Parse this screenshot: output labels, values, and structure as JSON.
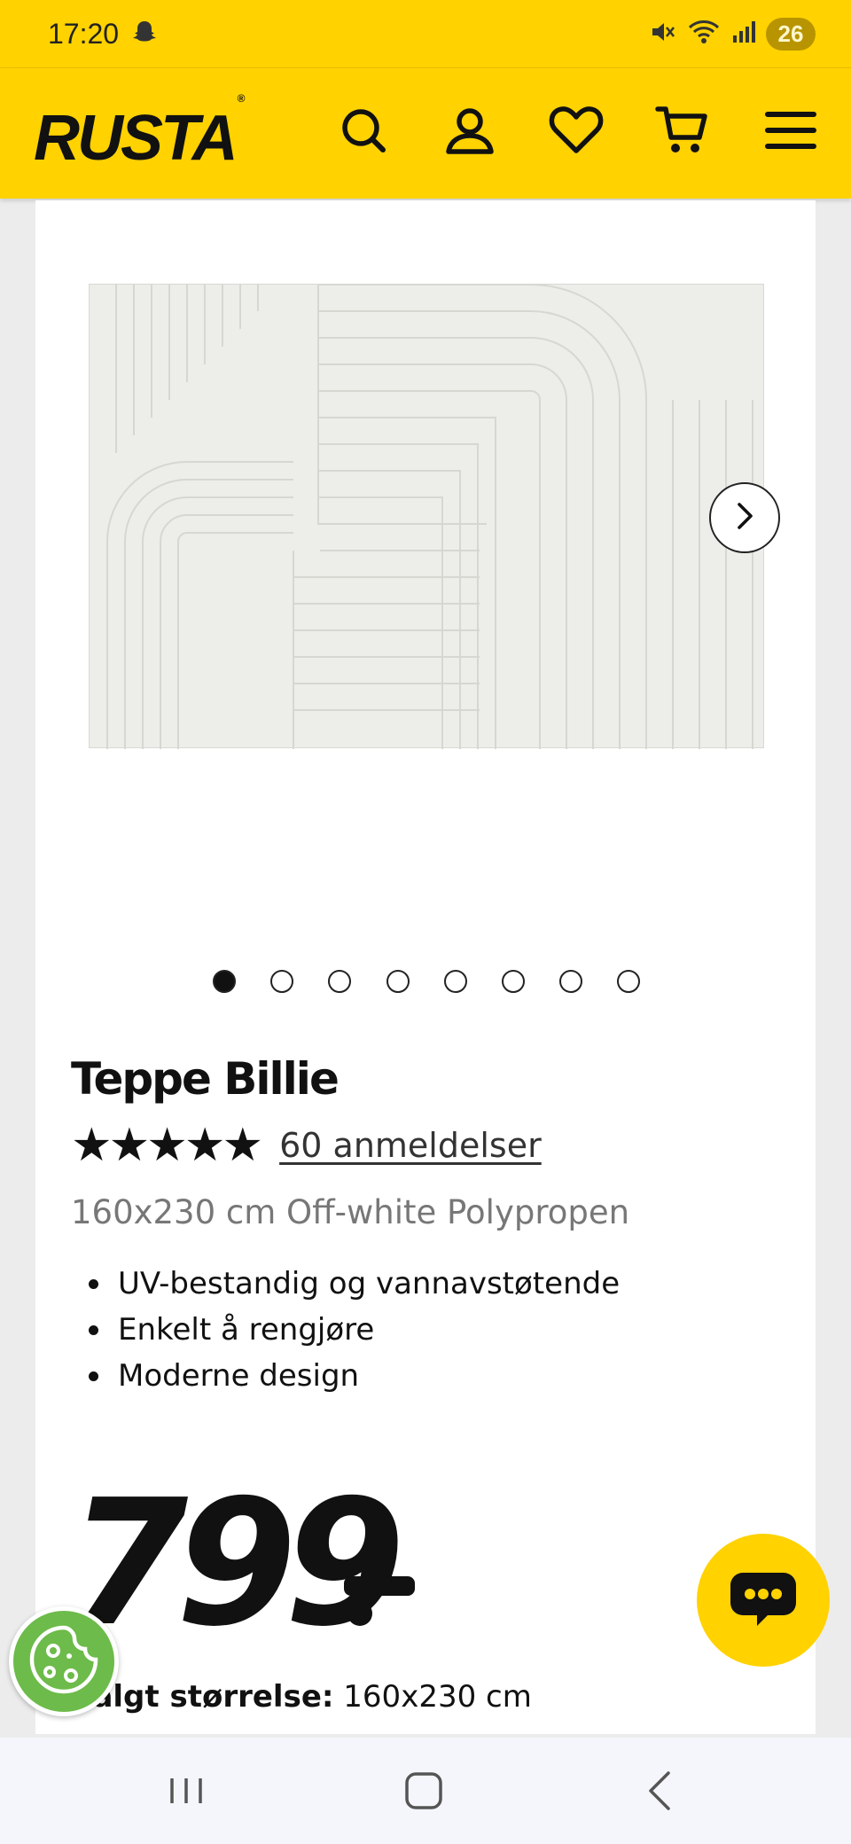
{
  "status_bar": {
    "time": "17:20",
    "battery": "26",
    "icons": [
      "snapchat-ghost-icon",
      "mute-icon",
      "wifi-icon",
      "signal-icon",
      "battery-icon"
    ]
  },
  "header": {
    "logo": "RUSTA",
    "logo_mark": "®",
    "icons": [
      "search-icon",
      "account-icon",
      "heart-icon",
      "cart-icon",
      "menu-icon"
    ]
  },
  "gallery": {
    "image_alt": "Teppe Billie off-white rug",
    "dots_total": 8,
    "active_index": 0
  },
  "product": {
    "title": "Teppe Billie",
    "stars": "★★★★★",
    "rating": 5,
    "reviews": "60 anmeldelser",
    "subtitle": "160x230 cm Off-white Polypropen",
    "features": [
      "UV-bestandig og vannavstøtende",
      "Enkelt å rengjøre",
      "Moderne design"
    ],
    "price": "799",
    "price_suffix": ",-",
    "size_label": "Valgt størrelse:",
    "size_value": "160x230 cm"
  },
  "colors": {
    "brand_yellow": "#ffd200",
    "text": "#111111",
    "muted": "#777777",
    "cookie_green": "#6dbb4a"
  }
}
